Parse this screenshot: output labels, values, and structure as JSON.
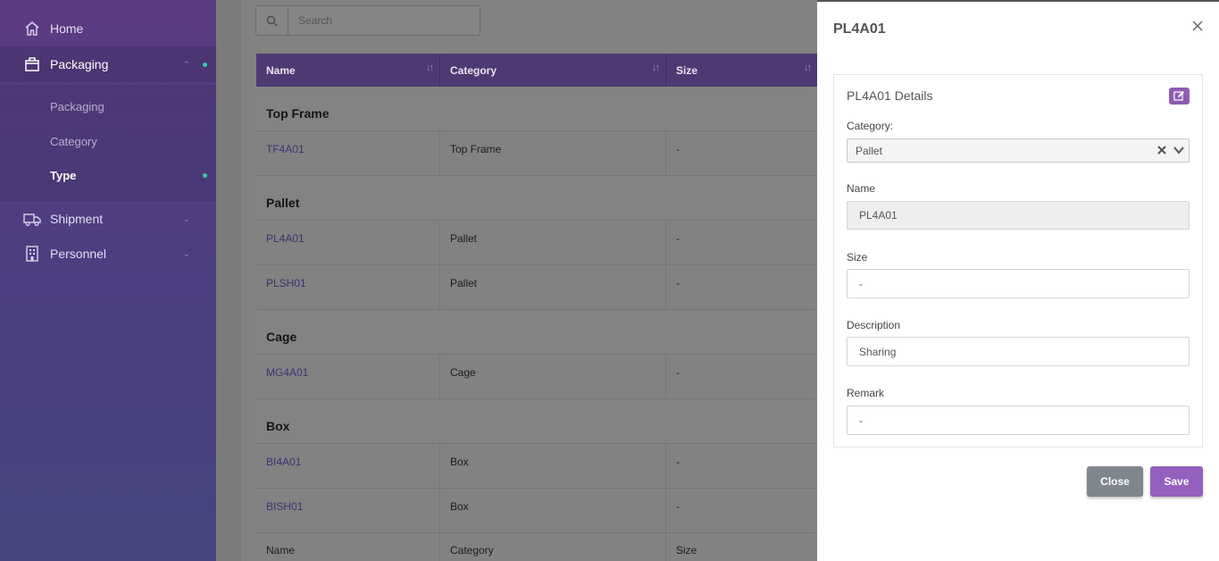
{
  "sidebar": {
    "items": [
      {
        "label": "Home",
        "icon": "home-icon"
      },
      {
        "label": "Packaging",
        "icon": "box-icon"
      },
      {
        "label": "Shipment",
        "icon": "truck-icon"
      },
      {
        "label": "Personnel",
        "icon": "building-icon"
      }
    ],
    "sub_items": [
      {
        "label": "Packaging"
      },
      {
        "label": "Category"
      },
      {
        "label": "Type"
      }
    ]
  },
  "search": {
    "placeholder": "Search"
  },
  "table": {
    "columns": [
      "Name",
      "Category",
      "Size"
    ],
    "groups": [
      {
        "label": "Top Frame",
        "rows": [
          {
            "name": "TF4A01",
            "category": "Top Frame",
            "size": "-"
          }
        ]
      },
      {
        "label": "Pallet",
        "rows": [
          {
            "name": "PL4A01",
            "category": "Pallet",
            "size": "-"
          },
          {
            "name": "PLSH01",
            "category": "Pallet",
            "size": "-"
          }
        ]
      },
      {
        "label": "Cage",
        "rows": [
          {
            "name": "MG4A01",
            "category": "Cage",
            "size": "-"
          }
        ]
      },
      {
        "label": "Box",
        "rows": [
          {
            "name": "BI4A01",
            "category": "Box",
            "size": "-"
          },
          {
            "name": "BISH01",
            "category": "Box",
            "size": "-"
          }
        ]
      }
    ],
    "footer": [
      "Name",
      "Category",
      "Size"
    ]
  },
  "panel": {
    "title": "PL4A01",
    "card_title": "PL4A01 Details",
    "category_label": "Category:",
    "category_value": "Pallet",
    "name_label": "Name",
    "name_value": "PL4A01",
    "size_label": "Size",
    "size_value": "-",
    "description_label": "Description",
    "description_value": "Sharing",
    "remark_label": "Remark",
    "remark_value": "-",
    "close_button": "Close",
    "save_button": "Save"
  },
  "colors": {
    "accent": "#9460bf",
    "sidebar": "#4c3e80",
    "status_dot": "#2ecfa3"
  }
}
